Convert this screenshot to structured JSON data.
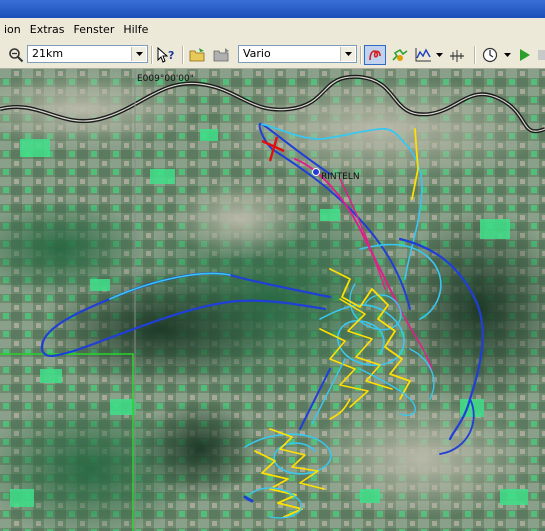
{
  "menu": {
    "items": [
      "ion",
      "Extras",
      "Fenster",
      "Hilfe"
    ]
  },
  "toolbar": {
    "zoom_icon": "magnifier-zoom-icon",
    "scale_value": "21km",
    "mode_value": "Vario",
    "icons": [
      "cursor-help-icon",
      "open-folder-icon",
      "save-icon",
      "flight-path-icon",
      "thermal-icon",
      "graph-icon",
      "wind-icon",
      "clock-icon",
      "play-icon"
    ]
  },
  "map": {
    "meridian_label": "E009°00'00\"",
    "place_label": "RINTELN"
  },
  "colors": {
    "track_blue": "#1f3fd6",
    "track_cyan": "#38c7f0",
    "track_yellow": "#ffe000",
    "track_magenta": "#e0208a",
    "airspace_green": "#26d42a",
    "marker_red": "#e01010"
  }
}
